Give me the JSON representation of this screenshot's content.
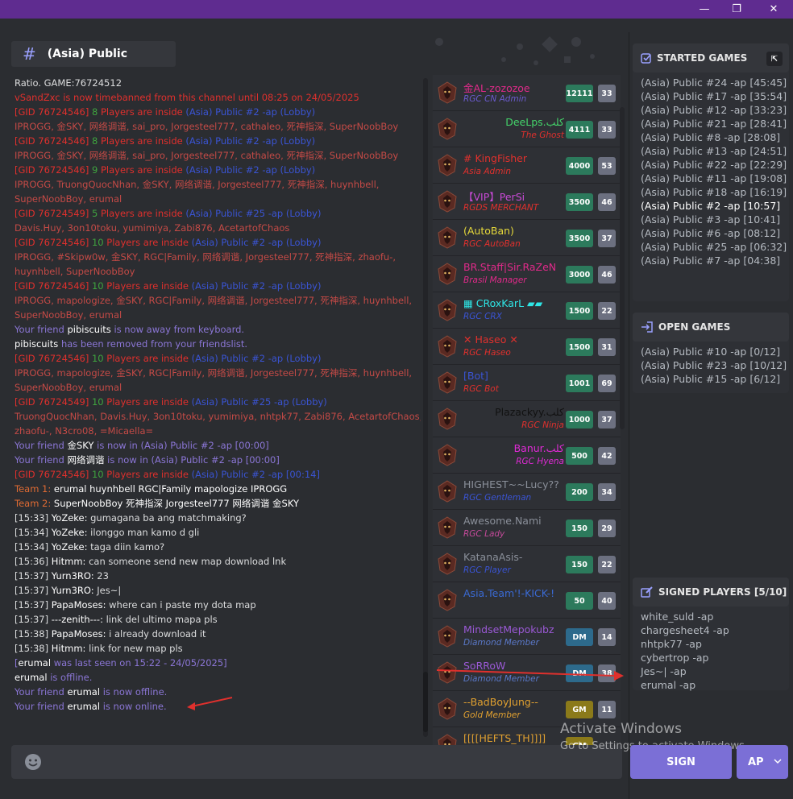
{
  "window": {
    "minimize": "—",
    "maximize": "❐",
    "close": "✕"
  },
  "channel": {
    "hash": "#",
    "name": "(Asia) Public"
  },
  "chat": [
    [
      {
        "t": "Ratio. GAME:76724512",
        "c": "grey"
      }
    ],
    [
      {
        "t": "vSandZxc is now timebanned from this channel until 08:25 on 24/05/2025",
        "c": "red"
      }
    ],
    [
      {
        "t": "[GID 76724546]",
        "c": "red"
      },
      {
        "t": " 8 ",
        "c": "green"
      },
      {
        "t": "Players are inside ",
        "c": "red"
      },
      {
        "t": "(Asia) Public #2 -ap (Lobby)",
        "c": "blue"
      }
    ],
    [
      {
        "t": "IPROGG, 金SKY, 网络调谐, sai_pro, Jorgesteel777, cathaleo, 死神指深, SuperNoobBoy",
        "c": "dred"
      }
    ],
    [
      {
        "t": "[GID 76724546]",
        "c": "red"
      },
      {
        "t": " 8 ",
        "c": "green"
      },
      {
        "t": "Players are inside ",
        "c": "red"
      },
      {
        "t": "(Asia) Public #2 -ap (Lobby)",
        "c": "blue"
      }
    ],
    [
      {
        "t": "IPROGG, 金SKY, 网络调谐, sai_pro, Jorgesteel777, cathaleo, 死神指深, SuperNoobBoy",
        "c": "dred"
      }
    ],
    [
      {
        "t": "[GID 76724546]",
        "c": "red"
      },
      {
        "t": " 9 ",
        "c": "green"
      },
      {
        "t": "Players are inside ",
        "c": "red"
      },
      {
        "t": "(Asia) Public #2 -ap (Lobby)",
        "c": "blue"
      }
    ],
    [
      {
        "t": "IPROGG, TruongQuocNhan, 金SKY, 网络调谐, Jorgesteel777, 死神指深, huynhbell,",
        "c": "dred"
      }
    ],
    [
      {
        "t": "SuperNoobBoy, erumal",
        "c": "dred"
      }
    ],
    [
      {
        "t": "[GID 76724549]",
        "c": "red"
      },
      {
        "t": " 5 ",
        "c": "green"
      },
      {
        "t": "Players are inside ",
        "c": "red"
      },
      {
        "t": "(Asia) Public #25 -ap (Lobby)",
        "c": "blue"
      }
    ],
    [
      {
        "t": "Davis.Huy, 3on10toku, yumimiya, Zabi876, AcetartofChaos",
        "c": "dred"
      }
    ],
    [
      {
        "t": "[GID 76724546]",
        "c": "red"
      },
      {
        "t": " 10 ",
        "c": "green"
      },
      {
        "t": "Players are inside ",
        "c": "red"
      },
      {
        "t": "(Asia) Public #2 -ap (Lobby)",
        "c": "blue"
      }
    ],
    [
      {
        "t": "IPROGG, #Skipw0w, 金SKY, RGC|Family, 网络调谐, Jorgesteel777, 死神指深, zhaofu-,",
        "c": "dred"
      }
    ],
    [
      {
        "t": "huynhbell, SuperNoobBoy",
        "c": "dred"
      }
    ],
    [
      {
        "t": "[GID 76724546]",
        "c": "red"
      },
      {
        "t": " 10 ",
        "c": "green"
      },
      {
        "t": "Players are inside ",
        "c": "red"
      },
      {
        "t": "(Asia) Public #2 -ap (Lobby)",
        "c": "blue"
      }
    ],
    [
      {
        "t": "IPROGG, mapologize, 金SKY, RGC|Family, 网络调谐, Jorgesteel777, 死神指深, huynhbell,",
        "c": "dred"
      }
    ],
    [
      {
        "t": "SuperNoobBoy, erumal",
        "c": "dred"
      }
    ],
    [
      {
        "t": "Your friend ",
        "c": "purple"
      },
      {
        "t": "pibiscuits",
        "c": "white"
      },
      {
        "t": " is now away from keyboard.",
        "c": "purple"
      }
    ],
    [
      {
        "t": "pibiscuits",
        "c": "white"
      },
      {
        "t": " has been removed from your friendslist.",
        "c": "purple"
      }
    ],
    [
      {
        "t": "[GID 76724546]",
        "c": "red"
      },
      {
        "t": " 10 ",
        "c": "green"
      },
      {
        "t": "Players are inside ",
        "c": "red"
      },
      {
        "t": "(Asia) Public #2 -ap (Lobby)",
        "c": "blue"
      }
    ],
    [
      {
        "t": "IPROGG, mapologize, 金SKY, RGC|Family, 网络调谐, Jorgesteel777, 死神指深, huynhbell,",
        "c": "dred"
      }
    ],
    [
      {
        "t": "SuperNoobBoy, erumal",
        "c": "dred"
      }
    ],
    [
      {
        "t": "[GID 76724549]",
        "c": "red"
      },
      {
        "t": " 10 ",
        "c": "green"
      },
      {
        "t": "Players are inside ",
        "c": "red"
      },
      {
        "t": "(Asia) Public #25 -ap (Lobby)",
        "c": "blue"
      }
    ],
    [
      {
        "t": "TruongQuocNhan, Davis.Huy, 3on10toku, yumimiya, nhtpk77, Zabi876, AcetartofChaos,",
        "c": "dred"
      }
    ],
    [
      {
        "t": "zhaofu-, N3cro08, =Micaella=",
        "c": "dred"
      }
    ],
    [
      {
        "t": "Your friend ",
        "c": "purple"
      },
      {
        "t": "金SKY",
        "c": "white"
      },
      {
        "t": " is now in (Asia) Public #2 -ap [00:00]",
        "c": "purple"
      }
    ],
    [
      {
        "t": "Your friend ",
        "c": "purple"
      },
      {
        "t": "网络调谐",
        "c": "white"
      },
      {
        "t": " is now in (Asia) Public #2 -ap [00:00]",
        "c": "purple"
      }
    ],
    [
      {
        "t": "[GID 76724546]",
        "c": "red"
      },
      {
        "t": " 10 ",
        "c": "green"
      },
      {
        "t": "Players are inside ",
        "c": "red"
      },
      {
        "t": "(Asia) Public #2 -ap [00:14]",
        "c": "blue"
      }
    ],
    [
      {
        "t": "Team 1:   ",
        "c": "orange"
      },
      {
        "t": "erumal    huynhbell    RGC|Family    mapologize    IPROGG",
        "c": "white"
      }
    ],
    [
      {
        "t": "Team 2:   ",
        "c": "orange"
      },
      {
        "t": "SuperNoobBoy    死神指深    Jorgesteel777    网络调谐    金SKY",
        "c": "white"
      }
    ],
    [
      {
        "t": "[15:33] ",
        "c": "grey"
      },
      {
        "t": "YoZeke:",
        "c": "white"
      },
      {
        "t": " gumagana ba ang matchmaking?",
        "c": "grey"
      }
    ],
    [
      {
        "t": "[15:34] ",
        "c": "grey"
      },
      {
        "t": "YoZeke:",
        "c": "white"
      },
      {
        "t": " ilonggo man kamo d gli",
        "c": "grey"
      }
    ],
    [
      {
        "t": "[15:34] ",
        "c": "grey"
      },
      {
        "t": "YoZeke:",
        "c": "white"
      },
      {
        "t": " taga diin kamo?",
        "c": "grey"
      }
    ],
    [
      {
        "t": "[15:36] ",
        "c": "grey"
      },
      {
        "t": "Hitmm:",
        "c": "white"
      },
      {
        "t": " can someone send new map download lnk",
        "c": "grey"
      }
    ],
    [
      {
        "t": "[15:37] ",
        "c": "grey"
      },
      {
        "t": "Yurn3RO:",
        "c": "white"
      },
      {
        "t": " 23",
        "c": "grey"
      }
    ],
    [
      {
        "t": "[15:37] ",
        "c": "grey"
      },
      {
        "t": "Yurn3RO:",
        "c": "white"
      },
      {
        "t": " Jes~|",
        "c": "grey"
      }
    ],
    [
      {
        "t": "[15:37] ",
        "c": "grey"
      },
      {
        "t": "PapaMoses:",
        "c": "white"
      },
      {
        "t": " where can i paste my dota map",
        "c": "grey"
      }
    ],
    [
      {
        "t": "[15:37] ",
        "c": "grey"
      },
      {
        "t": "---zenith---:",
        "c": "white"
      },
      {
        "t": " link del ultimo mapa pls",
        "c": "grey"
      }
    ],
    [
      {
        "t": "[15:38] ",
        "c": "grey"
      },
      {
        "t": "PapaMoses:",
        "c": "white"
      },
      {
        "t": " i already download it",
        "c": "grey"
      }
    ],
    [
      {
        "t": "[15:38] ",
        "c": "grey"
      },
      {
        "t": "Hitmm:",
        "c": "white"
      },
      {
        "t": " link for new map pls",
        "c": "grey"
      }
    ],
    [
      {
        "t": "[",
        "c": "purple"
      },
      {
        "t": "erumal",
        "c": "white"
      },
      {
        "t": " was last seen on 15:22 - 24/05/2025]",
        "c": "purple"
      }
    ],
    [
      {
        "t": "erumal",
        "c": "white"
      },
      {
        "t": " is offline.",
        "c": "purple"
      }
    ],
    [
      {
        "t": "Your friend ",
        "c": "purple"
      },
      {
        "t": "erumal",
        "c": "white"
      },
      {
        "t": " is now offline.",
        "c": "purple"
      }
    ],
    [
      {
        "t": "Your friend ",
        "c": "purple"
      },
      {
        "t": "erumal",
        "c": "white"
      },
      {
        "t": " is now online.",
        "c": "purple"
      }
    ]
  ],
  "players": [
    {
      "name": "金AL-zozozoe",
      "nameColor": "#e02a8a",
      "role": "RGC CN Admin",
      "roleColor": "#6a5acd",
      "elo": "12111",
      "count": "33",
      "badge": "elo",
      "align": "left"
    },
    {
      "name": "DeeLps.كلب",
      "nameColor": "#44d46a",
      "role": "The Ghost",
      "roleColor": "#e0302d",
      "elo": "4111",
      "count": "33",
      "badge": "elo",
      "align": "right"
    },
    {
      "name": "# KingFisher",
      "nameColor": "#e0302d",
      "role": "Asia Admin",
      "roleColor": "#e0302d",
      "elo": "4000",
      "count": "53",
      "badge": "elo",
      "align": "left"
    },
    {
      "name": "【VIP】PerSi",
      "nameColor": "#c84ad6",
      "role": "RGDS MERCHANT",
      "roleColor": "#e0302d",
      "elo": "3500",
      "count": "46",
      "badge": "elo",
      "align": "left"
    },
    {
      "name": "(AutoBan)",
      "nameColor": "#e6d93a",
      "role": "RGC AutoBan",
      "roleColor": "#e0302d",
      "elo": "3500",
      "count": "37",
      "badge": "elo",
      "align": "left"
    },
    {
      "name": "BR.Staff|Sir.RaZeN",
      "nameColor": "#e02a8a",
      "role": "Brasil Manager",
      "roleColor": "#e02a8a",
      "elo": "3000",
      "count": "46",
      "badge": "elo",
      "align": "left"
    },
    {
      "name": "▦ CRoxKarL ▰▰",
      "nameColor": "#2ee6e6",
      "role": "RGC CRX",
      "roleColor": "#3a54d4",
      "elo": "1500",
      "count": "22",
      "badge": "elo",
      "align": "left"
    },
    {
      "name": "✕ Haseo ✕",
      "nameColor": "#e0302d",
      "role": "RGC Haseo",
      "roleColor": "#e0302d",
      "elo": "1500",
      "count": "31",
      "badge": "elo",
      "align": "left"
    },
    {
      "name": "[Bot]",
      "nameColor": "#3a54d4",
      "role": "RGC Bot",
      "roleColor": "#e0302d",
      "elo": "1001",
      "count": "69",
      "badge": "elo",
      "align": "left"
    },
    {
      "name": "Plazackyy.كلب",
      "nameColor": "#111111",
      "role": "RGC Ninja",
      "roleColor": "#e0302d",
      "elo": "1000",
      "count": "37",
      "badge": "elo",
      "align": "right"
    },
    {
      "name": "Banur.كلب",
      "nameColor": "#e02ad6",
      "role": "RGC Hyena",
      "roleColor": "#e02ad6",
      "elo": "500",
      "count": "42",
      "badge": "elo",
      "align": "right"
    },
    {
      "name": "HIGHEST~~Lucy??",
      "nameColor": "#8a8f99",
      "role": "RGC Gentleman",
      "roleColor": "#3a54d4",
      "elo": "200",
      "count": "34",
      "badge": "elo",
      "align": "left"
    },
    {
      "name": "Awesome.Nami",
      "nameColor": "#8a8f99",
      "role": "RGC Lady",
      "roleColor": "#c44a9a",
      "elo": "150",
      "count": "29",
      "badge": "elo",
      "align": "left"
    },
    {
      "name": "KatanaAsis-",
      "nameColor": "#8a8f99",
      "role": "RGC Player",
      "roleColor": "#3a54d4",
      "elo": "150",
      "count": "22",
      "badge": "elo",
      "align": "left"
    },
    {
      "name": "Asia.Team'!-KICK-!",
      "nameColor": "#3a6ad4",
      "role": "",
      "roleColor": "#3a54d4",
      "elo": "50",
      "count": "40",
      "badge": "elo",
      "align": "left"
    },
    {
      "name": "MindsetMepokubz",
      "nameColor": "#9b59d6",
      "role": "Diamond Member",
      "roleColor": "#5a78c8",
      "elo": "DM",
      "count": "14",
      "badge": "dm",
      "align": "left"
    },
    {
      "name": "SoRRoW",
      "nameColor": "#9b59d6",
      "role": "Diamond Member",
      "roleColor": "#5a78c8",
      "elo": "DM",
      "count": "38",
      "badge": "dm",
      "align": "left"
    },
    {
      "name": "--BadBoyJung--",
      "nameColor": "#e0a030",
      "role": "Gold Member",
      "roleColor": "#e0a030",
      "elo": "GM",
      "count": "11",
      "badge": "gm",
      "align": "left"
    },
    {
      "name": "[[[[HEFTS_TH]]]]",
      "nameColor": "#e0a030",
      "role": "",
      "roleColor": "#e0a030",
      "elo": "GM",
      "count": "",
      "badge": "gm",
      "align": "left"
    }
  ],
  "started": {
    "title": "STARTED GAMES",
    "items": [
      "(Asia) Public #24 -ap [45:45]",
      "(Asia) Public #17 -ap [35:54]",
      "(Asia) Public #12 -ap [33:23]",
      "(Asia) Public #21 -ap [28:41]",
      "(Asia) Public #8 -ap [28:08]",
      "(Asia) Public #13 -ap [24:51]",
      "(Asia) Public #22 -ap [22:29]",
      "(Asia) Public #11 -ap [19:08]",
      "(Asia) Public #18 -ap [16:19]",
      "(Asia) Public #2 -ap [10:57]",
      "(Asia) Public #3 -ap [10:41]",
      "(Asia) Public #6 -ap [08:12]",
      "(Asia) Public #25 -ap [06:32]",
      "(Asia) Public #7 -ap [04:38]"
    ],
    "highlight": 9
  },
  "open": {
    "title": "OPEN GAMES",
    "items": [
      "(Asia) Public #10 -ap [0/12]",
      "(Asia) Public #23 -ap [10/12]",
      "(Asia) Public #15 -ap [6/12]"
    ]
  },
  "signed": {
    "title": "SIGNED PLAYERS [5/10]",
    "items": [
      "white_suld -ap",
      "chargesheet4 -ap",
      "nhtpk77 -ap",
      "cybertrop -ap",
      "Jes~| -ap",
      "erumal -ap"
    ]
  },
  "buttons": {
    "sign": "SIGN",
    "ap": "AP"
  },
  "watermark": {
    "line1": "Activate Windows",
    "line2": "Go to Settings to activate Windows."
  },
  "colors": {
    "titlebar": "#5f2c90",
    "accent": "#7b6fd6",
    "bg": "#2b2d31"
  }
}
